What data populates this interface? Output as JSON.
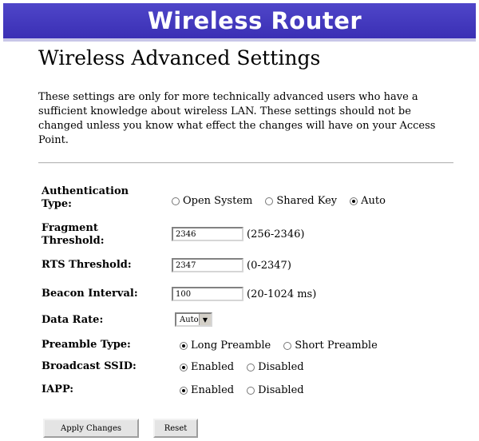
{
  "banner": {
    "title": "Wireless Router"
  },
  "page": {
    "title": "Wireless Advanced Settings",
    "intro": "These settings are only for more technically advanced users who have a sufficient knowledge about wireless LAN. These settings should not be changed unless you know what effect the changes will have on your Access Point."
  },
  "form": {
    "auth": {
      "label": "Authentication Type:",
      "options": [
        "Open System",
        "Shared Key",
        "Auto"
      ],
      "selected": "Auto"
    },
    "fragment": {
      "label": "Fragment Threshold:",
      "value": "2346",
      "hint": "(256-2346)"
    },
    "rts": {
      "label": "RTS Threshold:",
      "value": "2347",
      "hint": "(0-2347)"
    },
    "beacon": {
      "label": "Beacon Interval:",
      "value": "100",
      "hint": "(20-1024 ms)"
    },
    "datarate": {
      "label": "Data Rate:",
      "value": "Auto"
    },
    "preamble": {
      "label": "Preamble Type:",
      "options": [
        "Long Preamble",
        "Short Preamble"
      ],
      "selected": "Long Preamble"
    },
    "ssid": {
      "label": "Broadcast SSID:",
      "options": [
        "Enabled",
        "Disabled"
      ],
      "selected": "Enabled"
    },
    "iapp": {
      "label": "IAPP:",
      "options": [
        "Enabled",
        "Disabled"
      ],
      "selected": "Enabled"
    }
  },
  "buttons": {
    "apply": "Apply Changes",
    "reset": "Reset"
  },
  "colors": {
    "banner": "#3a2fb4",
    "banner_text": "#ffffff"
  }
}
